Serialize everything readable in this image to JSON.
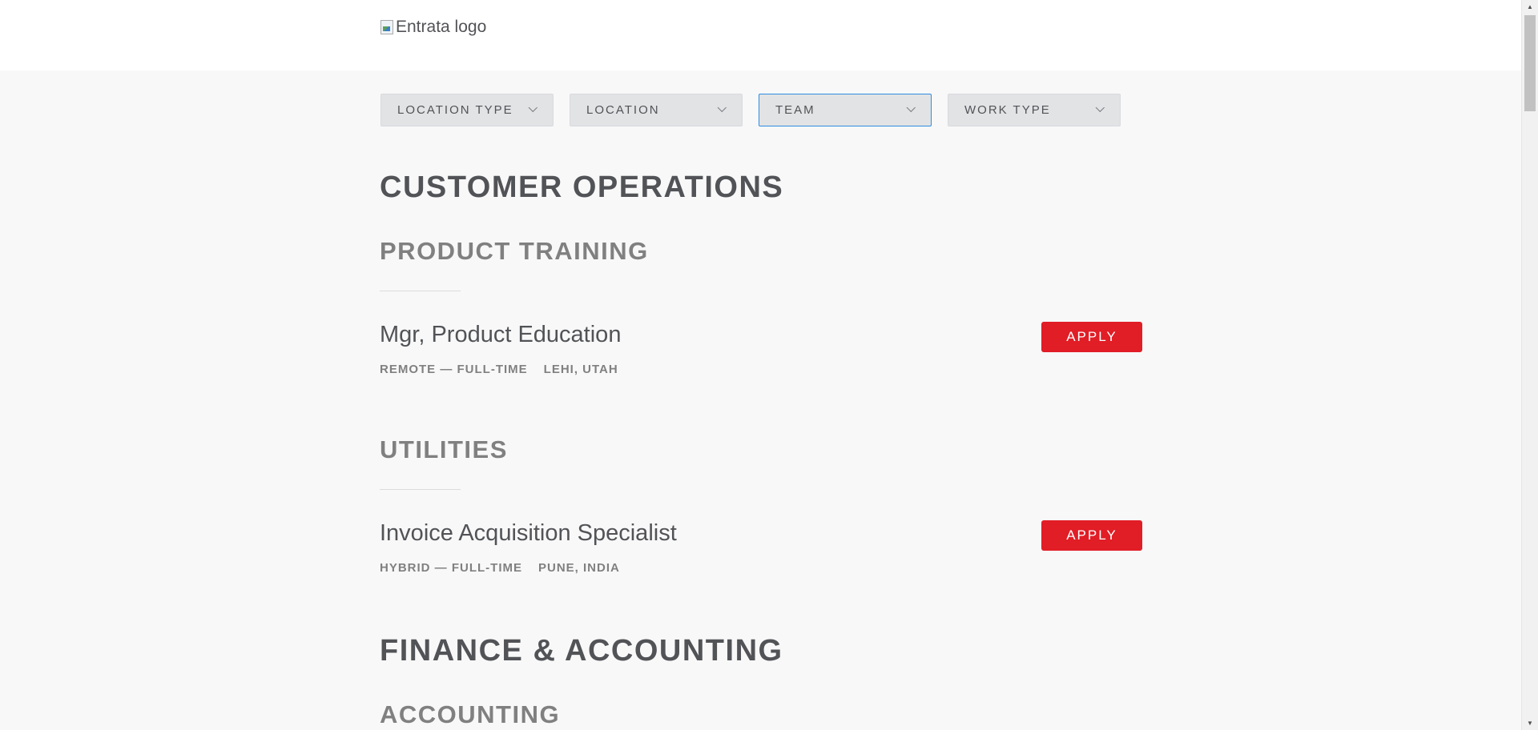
{
  "header": {
    "logo_alt": "Entrata logo"
  },
  "filters": [
    {
      "label": "LOCATION TYPE",
      "active": false
    },
    {
      "label": "LOCATION",
      "active": false
    },
    {
      "label": "TEAM",
      "active": true
    },
    {
      "label": "WORK TYPE",
      "active": false
    }
  ],
  "departments": [
    {
      "name": "CUSTOMER OPERATIONS",
      "teams": [
        {
          "name": "PRODUCT TRAINING",
          "jobs": [
            {
              "title": "Mgr, Product Education",
              "work_type": "REMOTE — FULL-TIME",
              "location": "LEHI, UTAH",
              "apply_label": "APPLY"
            }
          ]
        },
        {
          "name": "UTILITIES",
          "jobs": [
            {
              "title": "Invoice Acquisition Specialist",
              "work_type": "HYBRID — FULL-TIME",
              "location": "PUNE, INDIA",
              "apply_label": "APPLY"
            }
          ]
        }
      ]
    },
    {
      "name": "FINANCE & ACCOUNTING",
      "teams": [
        {
          "name": "ACCOUNTING",
          "jobs": []
        }
      ]
    }
  ],
  "colors": {
    "apply_button": "#e11d26",
    "active_filter_border": "#2f8ce0",
    "page_background": "#f8f8f8"
  }
}
